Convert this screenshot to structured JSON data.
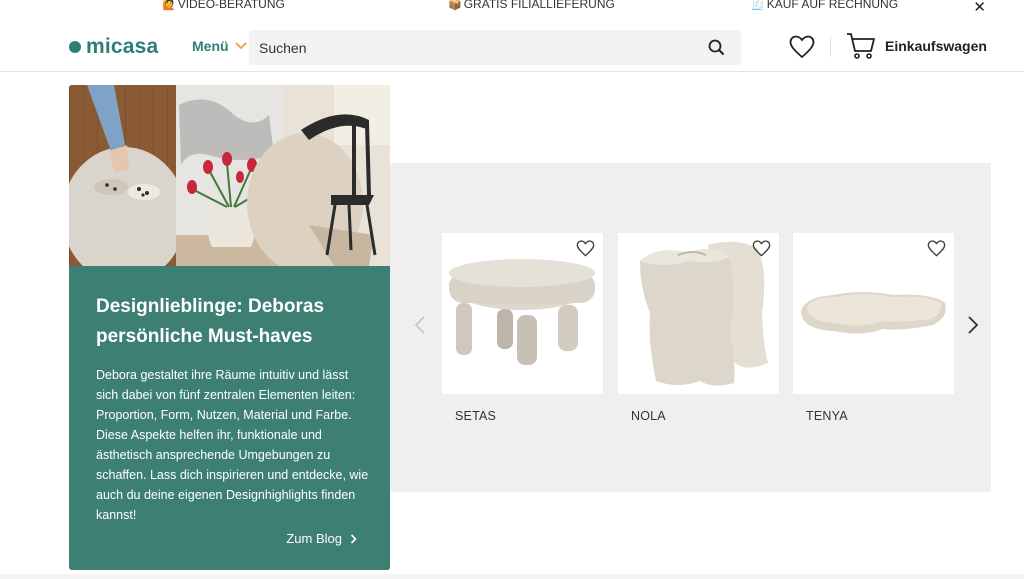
{
  "promo": {
    "items": [
      {
        "icon": "video-call-icon",
        "label": "VIDEO-BERATUNG"
      },
      {
        "icon": "package-icon",
        "label": "GRATIS FILIALLIEFERUNG"
      },
      {
        "icon": "invoice-icon",
        "label": "KAUF AUF RECHNUNG"
      }
    ],
    "close": "✕"
  },
  "header": {
    "logo": "micasa",
    "menu_label": "Menü",
    "search_placeholder": "Suchen",
    "cart_label": "Einkaufswagen"
  },
  "hero": {
    "title": "Designlieblinge: Deboras persönliche Must-haves",
    "text": "Debora gestaltet ihre Räume intuitiv und lässt sich dabei von fünf zentralen Elementen leiten: Proportion, Form, Nutzen, Material und Farbe. Diese Aspekte helfen ihr, funktionale und ästhetisch ansprechende Umgebungen zu schaffen. Lass dich inspirieren und entdecke, wie auch du deine eigenen Designhighlights finden kannst!",
    "link_label": "Zum Blog"
  },
  "products": [
    {
      "name": "SETAS"
    },
    {
      "name": "NOLA"
    },
    {
      "name": "TENYA"
    }
  ],
  "colors": {
    "brand": "#2f7e74",
    "hero_bg": "#3d7f73",
    "carousel_bg": "#efefef",
    "menu_chevron": "#e8a33c"
  }
}
